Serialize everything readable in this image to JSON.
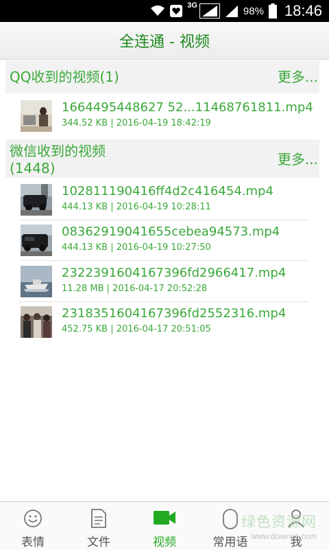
{
  "status_bar": {
    "network": "3G",
    "battery": "98%",
    "time": "18:46"
  },
  "header": {
    "title": "全连通 - 视频"
  },
  "sections": [
    {
      "title": "QQ收到的视频(1)",
      "more": "更多...",
      "items": [
        {
          "name": "1664495448627 52...11468761811.mp4",
          "meta": "344.52 KB | 2016-04-19 18:42:19"
        }
      ]
    },
    {
      "title_line1": "微信收到的视频",
      "title_line2": "(1448)",
      "more": "更多...",
      "items": [
        {
          "name": "102811190416ff4d2c416454.mp4",
          "meta": "444.13 KB | 2016-04-19 10:28:11"
        },
        {
          "name": "08362919041655cebea94573.mp4",
          "meta": "444.13 KB | 2016-04-19 10:27:50"
        },
        {
          "name": "2322391604167396fd2966417.mp4",
          "meta": "11.28 MB | 2016-04-17 20:52:28"
        },
        {
          "name": "2318351604167396fd2552316.mp4",
          "meta": "452.75 KB | 2016-04-17 20:51:05"
        }
      ]
    }
  ],
  "bottom_nav": [
    {
      "label": "表情",
      "icon": "smiley-icon"
    },
    {
      "label": "文件",
      "icon": "document-icon"
    },
    {
      "label": "视频",
      "icon": "video-camera-icon",
      "active": true
    },
    {
      "label": "常用语",
      "icon": "quote-icon"
    },
    {
      "label": "我",
      "icon": "person-icon"
    }
  ],
  "watermark": {
    "text": "绿色资源网",
    "url": "www.downcc.com"
  },
  "colors": {
    "accent": "#3aa83a",
    "active_nav": "#22aa22"
  }
}
